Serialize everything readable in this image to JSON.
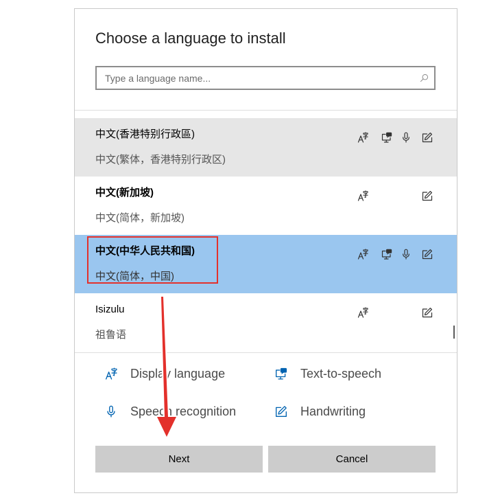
{
  "dialog": {
    "title": "Choose a language to install",
    "search": {
      "placeholder": "Type a language name...",
      "value": "",
      "icon": "search-icon"
    }
  },
  "languages": [
    {
      "name": "中文(香港特别行政區)",
      "native": "中文(繁体，香港特别行政区)",
      "features": [
        "display-language-icon",
        "text-to-speech-icon",
        "speech-recognition-icon",
        "handwriting-icon"
      ]
    },
    {
      "name": "中文(新加坡)",
      "native": "中文(简体，新加坡)",
      "features": [
        "display-language-icon",
        "handwriting-icon"
      ]
    },
    {
      "name": "中文(中华人民共和国)",
      "native": "中文(简体，中国)",
      "features": [
        "display-language-icon",
        "text-to-speech-icon",
        "speech-recognition-icon",
        "handwriting-icon"
      ]
    },
    {
      "name": "Isizulu",
      "native": "祖鲁语",
      "features": [
        "display-language-icon",
        "handwriting-icon"
      ]
    }
  ],
  "legend": [
    {
      "icon": "display-language-icon",
      "label": "Display language"
    },
    {
      "icon": "text-to-speech-icon",
      "label": "Text-to-speech"
    },
    {
      "icon": "speech-recognition-icon",
      "label": "Speech recognition"
    },
    {
      "icon": "handwriting-icon",
      "label": "Handwriting"
    }
  ],
  "buttons": {
    "next": "Next",
    "cancel": "Cancel"
  },
  "colors": {
    "selected": "#9ac6ef",
    "hover": "#e6e6e6",
    "accent": "#0063b1",
    "annotation": "#e3302b"
  }
}
